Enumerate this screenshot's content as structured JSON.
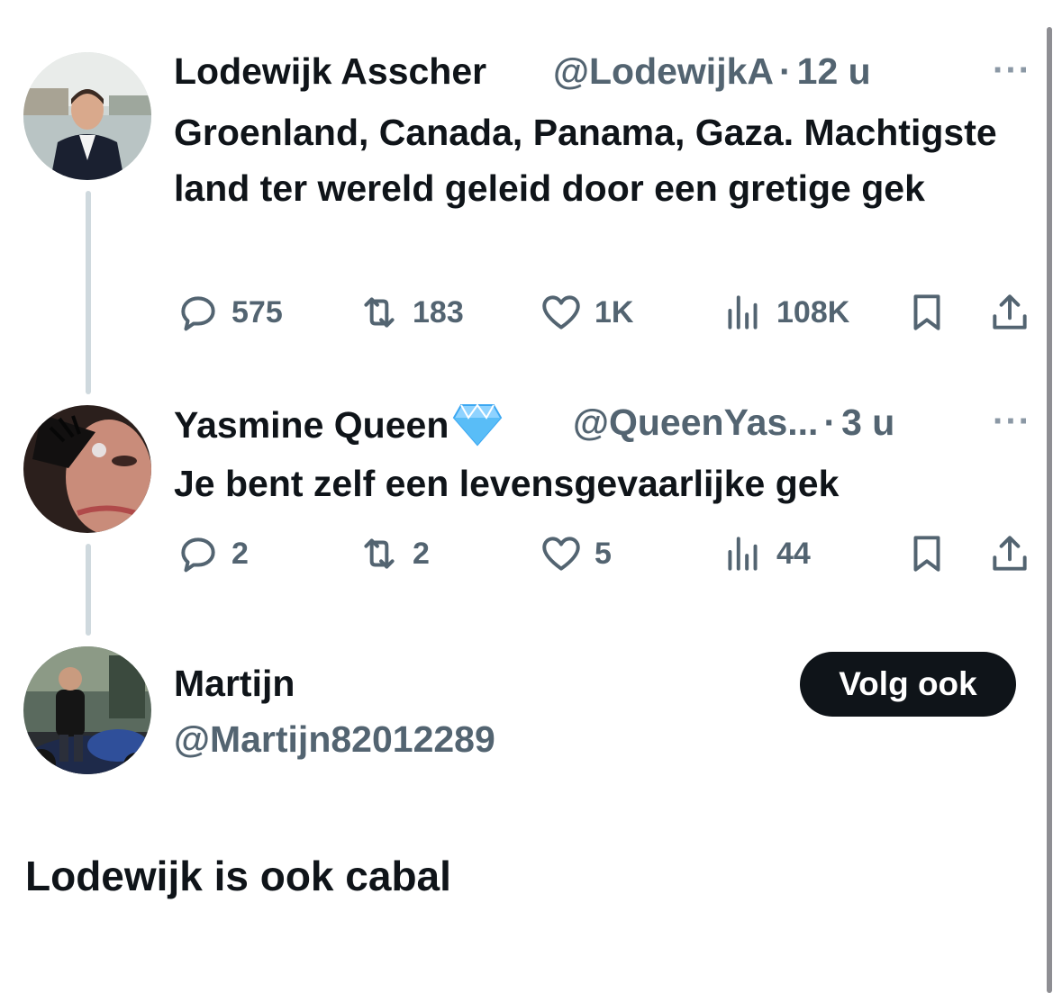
{
  "tweets": [
    {
      "name": "Lodewijk Asscher",
      "handle": "@LodewijkA",
      "separator": "·",
      "time": "12 u",
      "text": "Groenland, Canada, Panama, Gaza. Machtigste land ter wereld geleid door een gretige gek",
      "replies": "575",
      "retweets": "183",
      "likes": "1K",
      "views": "108K"
    },
    {
      "name": "Yasmine Queen",
      "badge": "💎",
      "handle": "@QueenYas...",
      "separator": "·",
      "time": "3 u",
      "text": "Je bent zelf een levensgevaarlijke gek",
      "replies": "2",
      "retweets": "2",
      "likes": "5",
      "views": "44"
    }
  ],
  "main_tweet": {
    "name": "Martijn",
    "handle": "@Martijn82012289",
    "follow_label": "Volg ook",
    "text": "Lodewijk is ook cabal"
  },
  "more_label": "···",
  "colors": {
    "text": "#0f1419",
    "secondary": "#536471",
    "line": "#cfd9de",
    "button": "#0f1419"
  },
  "icons": [
    "reply-icon",
    "retweet-icon",
    "like-icon",
    "views-icon",
    "bookmark-icon",
    "share-icon",
    "more-icon",
    "gem-icon"
  ]
}
